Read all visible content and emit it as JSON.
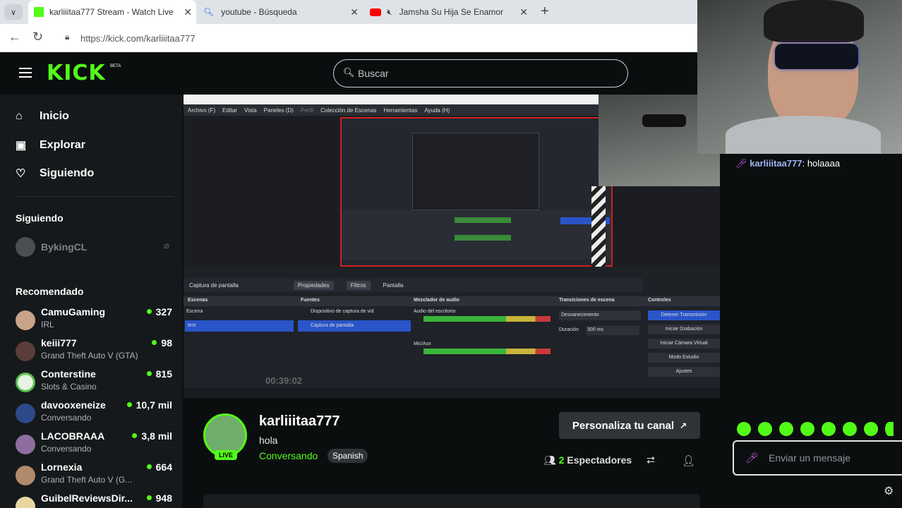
{
  "browser": {
    "tabs": [
      {
        "title": "karliiitaa777 Stream - Watch Live"
      },
      {
        "title": "youtube - Búsqueda"
      },
      {
        "title": "Jamsha Su Hija Se Enamor"
      }
    ],
    "url": "https://kick.com/karliiitaa777"
  },
  "kick": {
    "logo": "KICK",
    "logo_badge": "BETA",
    "search_placeholder": "Buscar",
    "nav": [
      {
        "label": "Inicio",
        "icon": "home-icon"
      },
      {
        "label": "Explorar",
        "icon": "explore-icon"
      },
      {
        "label": "Siguiendo",
        "icon": "heart-icon"
      }
    ],
    "following_header": "Siguiendo",
    "following": [
      {
        "name": "BykingCL"
      }
    ],
    "recommended_header": "Recomendado",
    "recommended": [
      {
        "name": "CamuGaming",
        "category": "IRL",
        "viewers": "327"
      },
      {
        "name": "keiii777",
        "category": "Grand Theft Auto V (GTA)",
        "viewers": "98"
      },
      {
        "name": "Conterstine",
        "category": "Slots & Casino",
        "viewers": "815"
      },
      {
        "name": "davooxeneize",
        "category": "Conversando",
        "viewers": "10,7 mil"
      },
      {
        "name": "LACOBRAAA",
        "category": "Conversando",
        "viewers": "3,8 mil"
      },
      {
        "name": "Lornexia",
        "category": "Grand Theft Auto V (G...",
        "viewers": "664"
      },
      {
        "name": "GuibelReviewsDir...",
        "category": "",
        "viewers": "948"
      }
    ]
  },
  "obs": {
    "menu": [
      "Archivo (F)",
      "Editar",
      "Vista",
      "Paneles (D)",
      "Perfil",
      "Colección de Escenas",
      "Herramientas",
      "Ayuda (H)"
    ],
    "source_bar": [
      "Captura de pantalla",
      "Propiedades",
      "Filtros",
      "Pantalla"
    ],
    "docks": [
      "Escenas",
      "Fuentes",
      "Mezclador de audio",
      "Transiciones de escena",
      "Controles"
    ],
    "scenes": [
      "Escena",
      "test"
    ],
    "sources": [
      "Dispositivo de captura de vid",
      "Captura de pantalla"
    ],
    "audio": [
      "Audio del escritorio",
      "Mic/Aux"
    ],
    "transition": "Desvanecimiento",
    "duration_label": "Duración",
    "duration_value": "300 ms",
    "controls": [
      "Detener Transmisión",
      "Iniciar Grabación",
      "Iniciar Cámara Virtual",
      "Modo Estudio",
      "Ajustes"
    ],
    "timer": "00:39:02"
  },
  "channel": {
    "name": "karliiitaa777",
    "title": "hola",
    "category": "Conversando",
    "language": "Spanish",
    "live_label": "LIVE",
    "customize_button": "Personaliza tu canal",
    "viewers_count": "2",
    "viewers_label": "Espectadores"
  },
  "chat": {
    "messages": [
      {
        "user": "karliiitaa777",
        "text": ": holaaaa"
      }
    ],
    "input_placeholder": "Enviar un mensaje",
    "emote_count": 8
  },
  "colors": {
    "brand": "#53fc18",
    "bg": "#0b0e0f",
    "sidebar": "#16191b"
  }
}
